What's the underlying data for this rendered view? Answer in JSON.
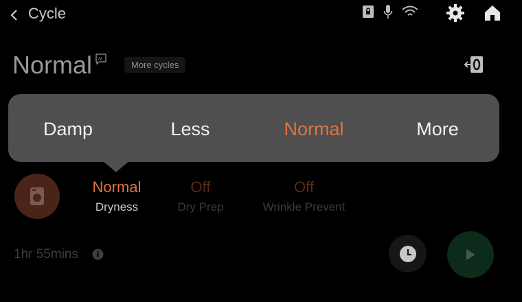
{
  "header": {
    "title": "Cycle",
    "icons": [
      "chevron-left-icon",
      "lock-icon",
      "mic-icon",
      "wifi-icon",
      "gear-icon",
      "home-icon"
    ]
  },
  "cycle": {
    "name": "Normal",
    "badge": "AI",
    "more_cycles": "More cycles"
  },
  "options": [
    {
      "value": "Normal",
      "label": "Dryness"
    },
    {
      "value": "Off",
      "label": "Dry Prep"
    },
    {
      "value": "Off",
      "label": "Wrinkle Prevent"
    }
  ],
  "time_remaining": "1hr 55mins",
  "popup": {
    "choices": [
      "Damp",
      "Less",
      "Normal",
      "More"
    ],
    "selected": "Normal"
  },
  "colors": {
    "accent": "#e2733f",
    "popup_bg": "#4f4f4f",
    "play_green": "#0d2b1a"
  }
}
